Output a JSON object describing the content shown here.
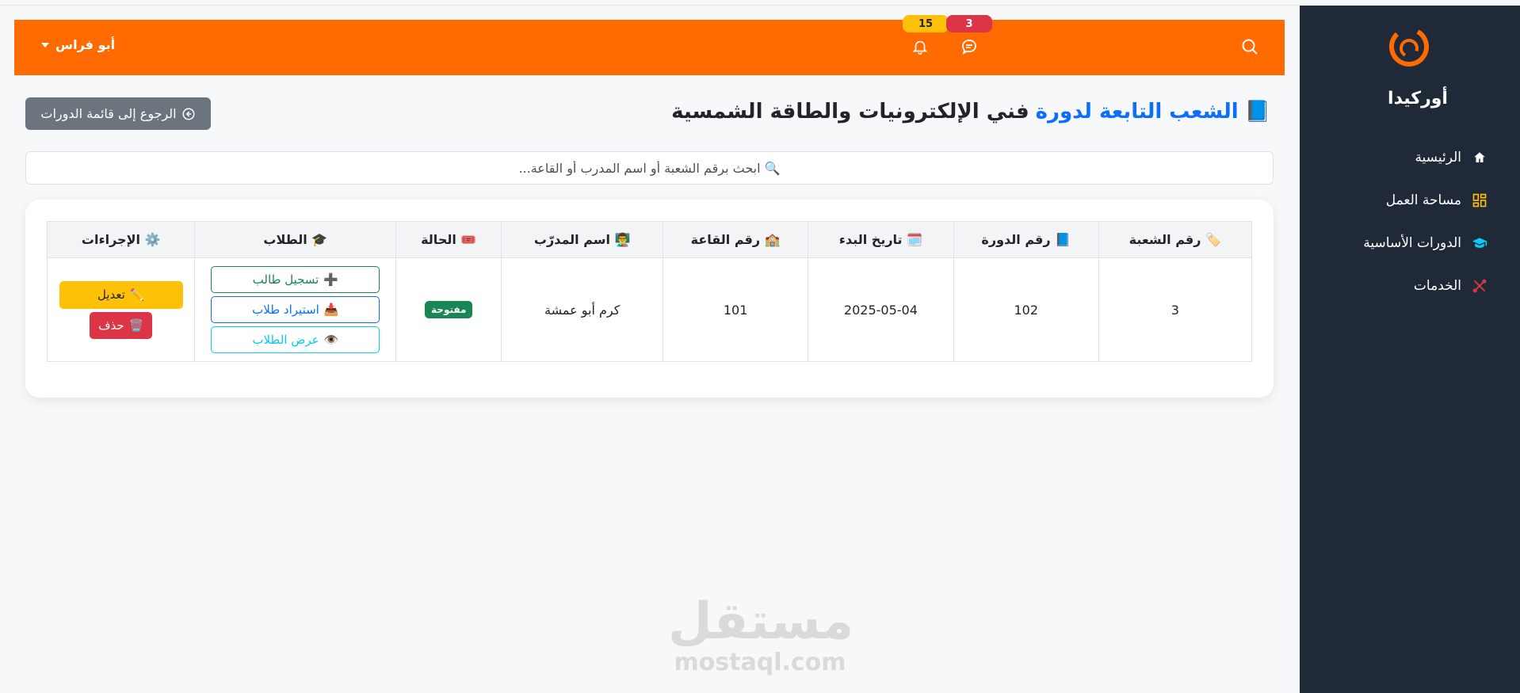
{
  "sidebar": {
    "brand": "أوركيدا",
    "items": [
      {
        "label": "الرئيسية",
        "icon": "home-icon",
        "color": "#ffffff"
      },
      {
        "label": "مساحة العمل",
        "icon": "grid-icon",
        "color": "#ffc107"
      },
      {
        "label": "الدورات الأساسية",
        "icon": "graduation-cap-icon",
        "color": "#0dcaf0"
      },
      {
        "label": "الخدمات",
        "icon": "tools-icon",
        "color": "#dc3545"
      }
    ]
  },
  "topbar": {
    "color": "#ff6b00",
    "user": "أبو فراس",
    "notifications_count": "15",
    "messages_count": "3"
  },
  "header": {
    "title_icon": "📘",
    "title_accent": "الشعب التابعة لدورة",
    "title_rest": "فني الإلكترونيات والطاقة الشمسية",
    "back_label": "الرجوع إلى قائمة الدورات"
  },
  "search": {
    "placeholder": "🔍 ابحث برقم الشعبة أو اسم المدرب أو القاعة..."
  },
  "table": {
    "headers": [
      {
        "icon": "🏷️",
        "label": "رقم الشعبة"
      },
      {
        "icon": "📘",
        "label": "رقم الدورة"
      },
      {
        "icon": "🗓️",
        "label": "تاريخ البدء"
      },
      {
        "icon": "🏫",
        "label": "رقم القاعة"
      },
      {
        "icon": "👨‍🏫",
        "label": "اسم المدرّب"
      },
      {
        "icon": "🎟️",
        "label": "الحالة"
      },
      {
        "icon": "🎓",
        "label": "الطلاب"
      },
      {
        "icon": "⚙️",
        "label": "الإجراءات"
      }
    ],
    "rows": [
      {
        "section": "3",
        "course": "102",
        "start_date": "2025-05-04",
        "room": "101",
        "trainer": "كرم أبو عمشة",
        "status": "مفتوحة",
        "students_actions": [
          {
            "icon": "➕",
            "label": "تسجيل طالب"
          },
          {
            "icon": "📥",
            "label": "استيراد طلاب"
          },
          {
            "icon": "👁️",
            "label": "عرض الطلاب"
          }
        ],
        "edit_label": "تعديل",
        "edit_icon": "✏️",
        "delete_label": "حذف",
        "delete_icon": "🗑️"
      }
    ]
  },
  "watermark": {
    "arabic": "مستقل",
    "latin": "mostaql.com"
  }
}
